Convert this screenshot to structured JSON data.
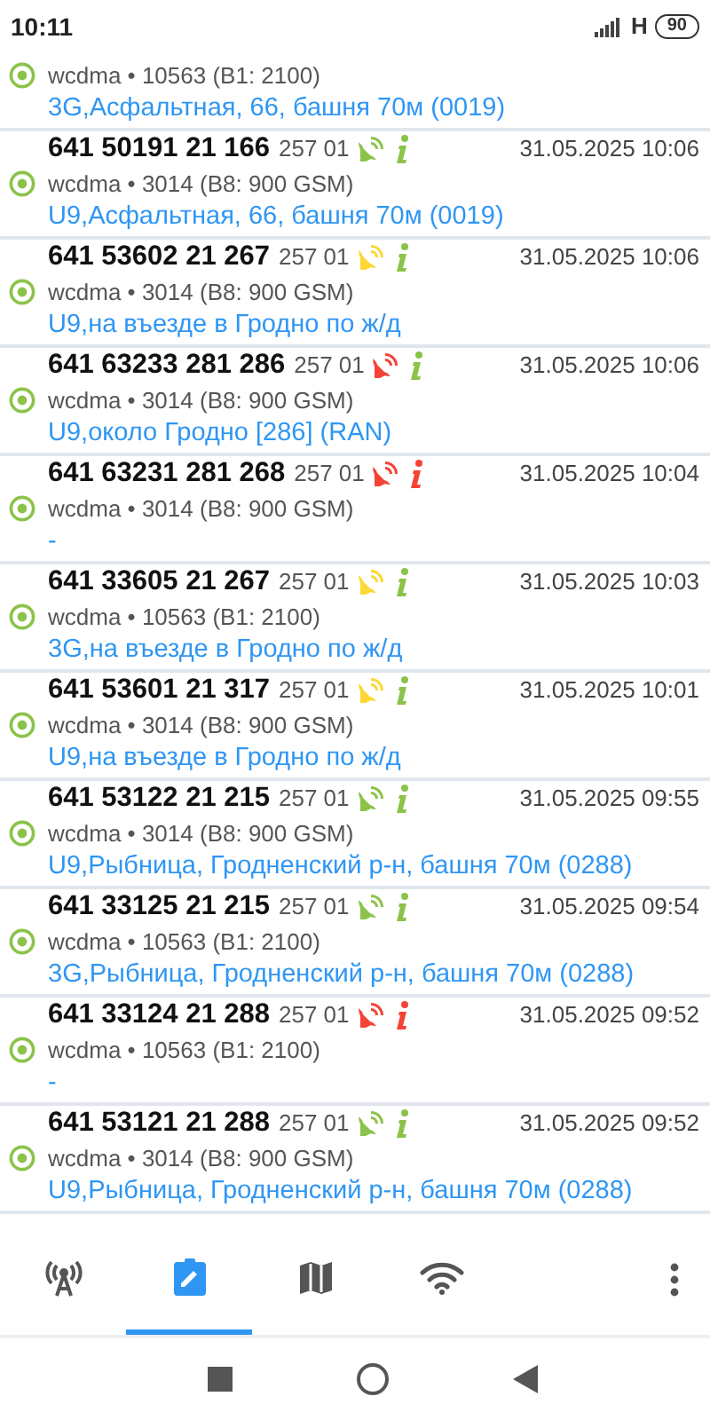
{
  "status_bar": {
    "time": "10:11",
    "network": "H",
    "battery": "90"
  },
  "rows": [
    {
      "tech": "wcdma • 10563 (B1: 2100)",
      "address": "3G,Асфальтная, 66, башня 70м (0019)"
    },
    {
      "cell_id": "641 50191 21 166",
      "plmn": "257 01",
      "signal_icon": {
        "color": "#8bc34a"
      },
      "info_icon": {
        "color": "#8bc34a"
      },
      "time": "31.05.2025 10:06",
      "tech": "wcdma • 3014 (B8: 900 GSM)",
      "address": "U9,Асфальтная, 66, башня 70м (0019)"
    },
    {
      "cell_id": "641 53602 21 267",
      "plmn": "257 01",
      "signal_icon": {
        "color": "#fdd835"
      },
      "info_icon": {
        "color": "#8bc34a"
      },
      "time": "31.05.2025 10:06",
      "tech": "wcdma • 3014 (B8: 900 GSM)",
      "address": "U9,на въезде в Гродно по ж/д"
    },
    {
      "cell_id": "641 63233 281 286",
      "plmn": "257 01",
      "signal_icon": {
        "color": "#f44336"
      },
      "info_icon": {
        "color": "#8bc34a"
      },
      "time": "31.05.2025 10:06",
      "tech": "wcdma • 3014 (B8: 900 GSM)",
      "address": "U9,около Гродно [286] (RAN)"
    },
    {
      "cell_id": "641 63231 281 268",
      "plmn": "257 01",
      "signal_icon": {
        "color": "#f44336"
      },
      "info_icon": {
        "color": "#f44336"
      },
      "time": "31.05.2025 10:04",
      "tech": "wcdma • 3014 (B8: 900 GSM)",
      "address": "-"
    },
    {
      "cell_id": "641 33605 21 267",
      "plmn": "257 01",
      "signal_icon": {
        "color": "#fdd835"
      },
      "info_icon": {
        "color": "#8bc34a"
      },
      "time": "31.05.2025 10:03",
      "tech": "wcdma • 10563 (B1: 2100)",
      "address": "3G,на въезде в Гродно по ж/д"
    },
    {
      "cell_id": "641 53601 21 317",
      "plmn": "257 01",
      "signal_icon": {
        "color": "#fdd835"
      },
      "info_icon": {
        "color": "#8bc34a"
      },
      "time": "31.05.2025 10:01",
      "tech": "wcdma • 3014 (B8: 900 GSM)",
      "address": "U9,на въезде в Гродно по ж/д"
    },
    {
      "cell_id": "641 53122 21 215",
      "plmn": "257 01",
      "signal_icon": {
        "color": "#8bc34a"
      },
      "info_icon": {
        "color": "#8bc34a"
      },
      "time": "31.05.2025 09:55",
      "tech": "wcdma • 3014 (B8: 900 GSM)",
      "address": "U9,Рыбница, Гродненский р-н, башня 70м (0288)"
    },
    {
      "cell_id": "641 33125 21 215",
      "plmn": "257 01",
      "signal_icon": {
        "color": "#8bc34a"
      },
      "info_icon": {
        "color": "#8bc34a"
      },
      "time": "31.05.2025 09:54",
      "tech": "wcdma • 10563 (B1: 2100)",
      "address": "3G,Рыбница, Гродненский р-н, башня 70м (0288)"
    },
    {
      "cell_id": "641 33124 21 288",
      "plmn": "257 01",
      "signal_icon": {
        "color": "#f44336"
      },
      "info_icon": {
        "color": "#f44336"
      },
      "time": "31.05.2025 09:52",
      "tech": "wcdma • 10563 (B1: 2100)",
      "address": "-"
    },
    {
      "cell_id": "641 53121 21 288",
      "plmn": "257 01",
      "signal_icon": {
        "color": "#8bc34a"
      },
      "info_icon": {
        "color": "#8bc34a"
      },
      "time": "31.05.2025 09:52",
      "tech": "wcdma • 3014 (B8: 900 GSM)",
      "address": "U9,Рыбница, Гродненский р-н, башня 70м (0288)"
    }
  ],
  "tabs": [
    {
      "kind": "tower",
      "selected": false
    },
    {
      "kind": "log",
      "selected": true
    },
    {
      "kind": "map",
      "selected": false
    },
    {
      "kind": "wifi",
      "selected": false
    }
  ]
}
